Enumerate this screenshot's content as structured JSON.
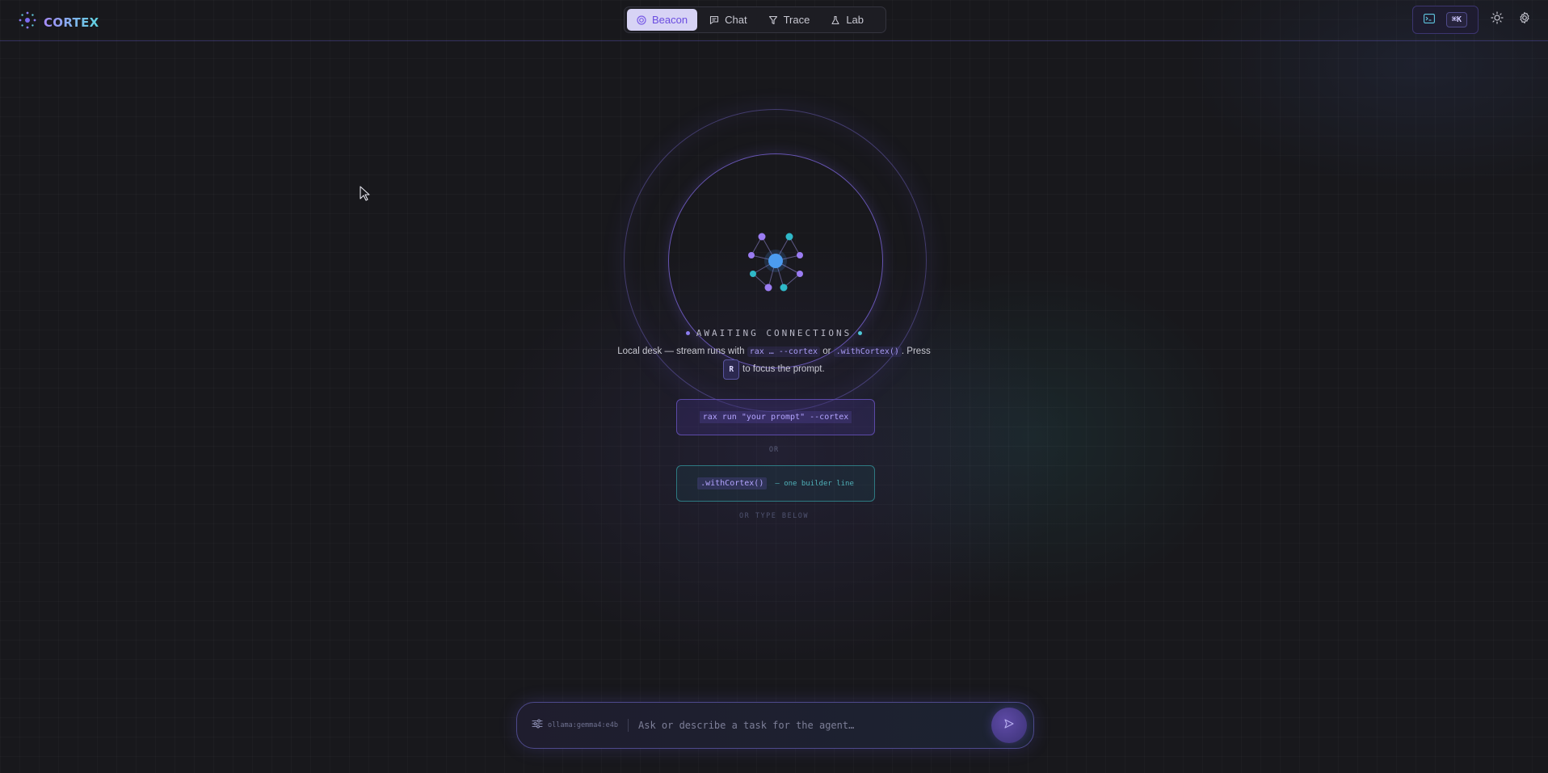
{
  "header": {
    "brand": "CORTEX",
    "tabs": [
      {
        "label": "Beacon",
        "icon": "beacon-icon",
        "active": true
      },
      {
        "label": "Chat",
        "icon": "chat-icon",
        "active": false
      },
      {
        "label": "Trace",
        "icon": "trace-icon",
        "active": false
      },
      {
        "label": "Lab",
        "icon": "flask-icon",
        "active": false
      }
    ],
    "shortcut": "⌘K",
    "colors": {
      "accent": "#a78bfa",
      "teal": "#5fd4e0",
      "active_tab_bg": "#d7d3f5"
    }
  },
  "beacon": {
    "status": "AWAITING CONNECTIONS",
    "desc_prefix": "Local desk — stream runs with",
    "desc_code1": "rax … --cortex",
    "desc_or": "or",
    "desc_code2": ".withCortex()",
    "desc_press": ". Press",
    "key": "R",
    "desc_suffix": "to focus the prompt.",
    "command": "rax run \"your prompt\" --cortex",
    "or_label": "OR",
    "builder_code": ".withCortex()",
    "builder_note": "— one builder line",
    "or_type": "OR TYPE BELOW"
  },
  "prompt": {
    "model": "ollama:gemma4:e4b",
    "placeholder": "Ask or describe a task for the agent…"
  }
}
